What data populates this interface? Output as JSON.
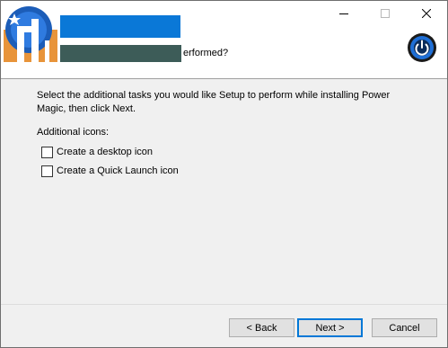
{
  "window": {
    "caption_buttons": {
      "minimize_icon": "minimize-icon",
      "maximize_icon": "maximize-icon",
      "close_icon": "close-icon"
    }
  },
  "header": {
    "subtitle_visible_tail": "erformed?",
    "logo_icon": "app-logo-icon",
    "setup_icon": "power-icon",
    "colors": {
      "title_redaction": "#0a78d7",
      "subtitle_redaction": "#3d5c58",
      "power_icon_ring": "#1f6fd6"
    }
  },
  "body": {
    "description": "Select the additional tasks you would like Setup to perform while installing Power Magic, then click Next.",
    "group_label": "Additional icons:",
    "tasks": [
      {
        "label": "Create a desktop icon",
        "checked": false
      },
      {
        "label": "Create a Quick Launch icon",
        "checked": false
      }
    ]
  },
  "footer": {
    "back_label": "< Back",
    "next_label": "Next >",
    "cancel_label": "Cancel"
  }
}
